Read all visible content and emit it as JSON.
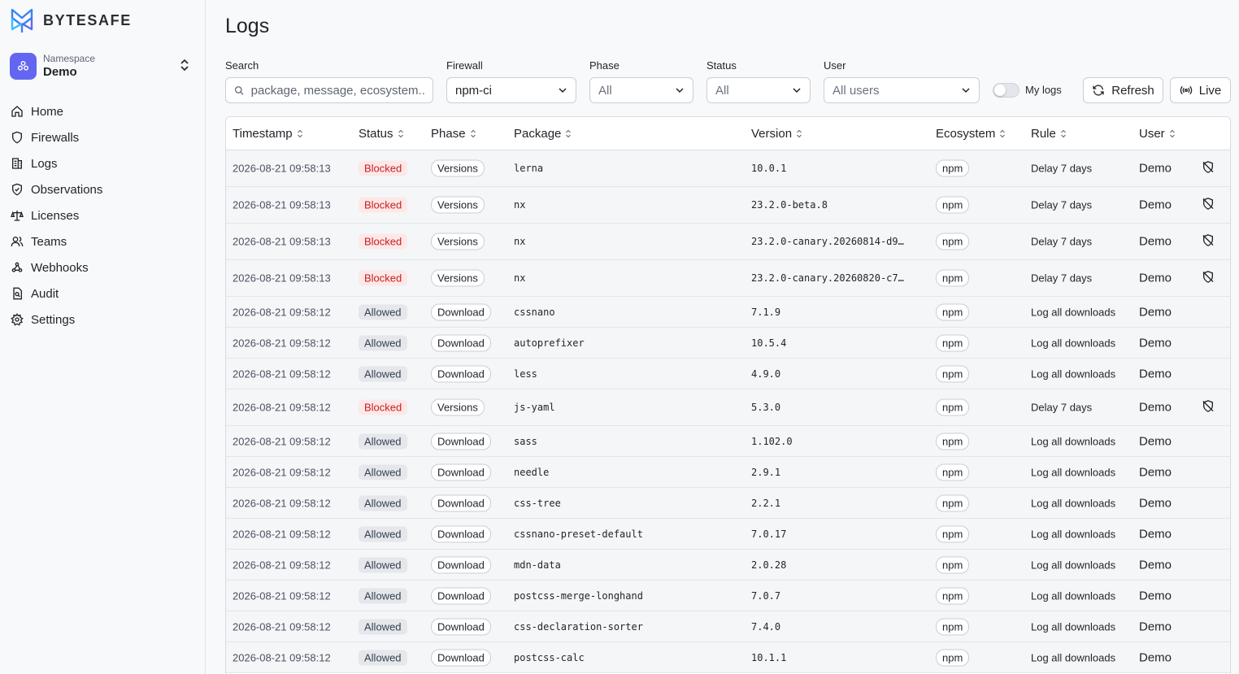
{
  "brand": {
    "name": "BYTESAFE"
  },
  "namespace": {
    "label": "Namespace",
    "value": "Demo"
  },
  "nav": [
    {
      "label": "Home",
      "icon": "home-icon"
    },
    {
      "label": "Firewalls",
      "icon": "shield-icon"
    },
    {
      "label": "Logs",
      "icon": "logs-icon"
    },
    {
      "label": "Observations",
      "icon": "shield-check-icon"
    },
    {
      "label": "Licenses",
      "icon": "scale-icon"
    },
    {
      "label": "Teams",
      "icon": "users-icon"
    },
    {
      "label": "Webhooks",
      "icon": "webhook-icon"
    },
    {
      "label": "Audit",
      "icon": "audit-icon"
    },
    {
      "label": "Settings",
      "icon": "gear-icon"
    }
  ],
  "page": {
    "title": "Logs"
  },
  "filters": {
    "search": {
      "label": "Search",
      "placeholder": "package, message, ecosystem..."
    },
    "firewall": {
      "label": "Firewall",
      "value": "npm-ci"
    },
    "phase": {
      "label": "Phase",
      "value": "All"
    },
    "status": {
      "label": "Status",
      "value": "All"
    },
    "user": {
      "label": "User",
      "value": "All users"
    },
    "my_logs": {
      "label": "My logs",
      "on": false
    },
    "refresh_label": "Refresh",
    "live_label": "Live"
  },
  "table": {
    "columns": [
      "Timestamp",
      "Status",
      "Phase",
      "Package",
      "Version",
      "Ecosystem",
      "Rule",
      "User"
    ],
    "rows": [
      {
        "timestamp": "2026-08-21 09:58:13",
        "status": "Blocked",
        "phase": "Versions",
        "package": "lerna",
        "version": "10.0.1",
        "ecosystem": "npm",
        "rule": "Delay 7 days",
        "user": "Demo"
      },
      {
        "timestamp": "2026-08-21 09:58:13",
        "status": "Blocked",
        "phase": "Versions",
        "package": "nx",
        "version": "23.2.0-beta.8",
        "ecosystem": "npm",
        "rule": "Delay 7 days",
        "user": "Demo"
      },
      {
        "timestamp": "2026-08-21 09:58:13",
        "status": "Blocked",
        "phase": "Versions",
        "package": "nx",
        "version": "23.2.0-canary.20260814-d9…",
        "ecosystem": "npm",
        "rule": "Delay 7 days",
        "user": "Demo"
      },
      {
        "timestamp": "2026-08-21 09:58:13",
        "status": "Blocked",
        "phase": "Versions",
        "package": "nx",
        "version": "23.2.0-canary.20260820-c7…",
        "ecosystem": "npm",
        "rule": "Delay 7 days",
        "user": "Demo"
      },
      {
        "timestamp": "2026-08-21 09:58:12",
        "status": "Allowed",
        "phase": "Download",
        "package": "cssnano",
        "version": "7.1.9",
        "ecosystem": "npm",
        "rule": "Log all downloads",
        "user": "Demo"
      },
      {
        "timestamp": "2026-08-21 09:58:12",
        "status": "Allowed",
        "phase": "Download",
        "package": "autoprefixer",
        "version": "10.5.4",
        "ecosystem": "npm",
        "rule": "Log all downloads",
        "user": "Demo"
      },
      {
        "timestamp": "2026-08-21 09:58:12",
        "status": "Allowed",
        "phase": "Download",
        "package": "less",
        "version": "4.9.0",
        "ecosystem": "npm",
        "rule": "Log all downloads",
        "user": "Demo"
      },
      {
        "timestamp": "2026-08-21 09:58:12",
        "status": "Blocked",
        "phase": "Versions",
        "package": "js-yaml",
        "version": "5.3.0",
        "ecosystem": "npm",
        "rule": "Delay 7 days",
        "user": "Demo"
      },
      {
        "timestamp": "2026-08-21 09:58:12",
        "status": "Allowed",
        "phase": "Download",
        "package": "sass",
        "version": "1.102.0",
        "ecosystem": "npm",
        "rule": "Log all downloads",
        "user": "Demo"
      },
      {
        "timestamp": "2026-08-21 09:58:12",
        "status": "Allowed",
        "phase": "Download",
        "package": "needle",
        "version": "2.9.1",
        "ecosystem": "npm",
        "rule": "Log all downloads",
        "user": "Demo"
      },
      {
        "timestamp": "2026-08-21 09:58:12",
        "status": "Allowed",
        "phase": "Download",
        "package": "css-tree",
        "version": "2.2.1",
        "ecosystem": "npm",
        "rule": "Log all downloads",
        "user": "Demo"
      },
      {
        "timestamp": "2026-08-21 09:58:12",
        "status": "Allowed",
        "phase": "Download",
        "package": "cssnano-preset-default",
        "version": "7.0.17",
        "ecosystem": "npm",
        "rule": "Log all downloads",
        "user": "Demo"
      },
      {
        "timestamp": "2026-08-21 09:58:12",
        "status": "Allowed",
        "phase": "Download",
        "package": "mdn-data",
        "version": "2.0.28",
        "ecosystem": "npm",
        "rule": "Log all downloads",
        "user": "Demo"
      },
      {
        "timestamp": "2026-08-21 09:58:12",
        "status": "Allowed",
        "phase": "Download",
        "package": "postcss-merge-longhand",
        "version": "7.0.7",
        "ecosystem": "npm",
        "rule": "Log all downloads",
        "user": "Demo"
      },
      {
        "timestamp": "2026-08-21 09:58:12",
        "status": "Allowed",
        "phase": "Download",
        "package": "css-declaration-sorter",
        "version": "7.4.0",
        "ecosystem": "npm",
        "rule": "Log all downloads",
        "user": "Demo"
      },
      {
        "timestamp": "2026-08-21 09:58:12",
        "status": "Allowed",
        "phase": "Download",
        "package": "postcss-calc",
        "version": "10.1.1",
        "ecosystem": "npm",
        "rule": "Log all downloads",
        "user": "Demo"
      }
    ]
  },
  "colors": {
    "accent": "#6366f1",
    "blocked_text": "#c81e1e",
    "blocked_bg": "#fde8e8",
    "logo_blue": "#3b82f6"
  }
}
